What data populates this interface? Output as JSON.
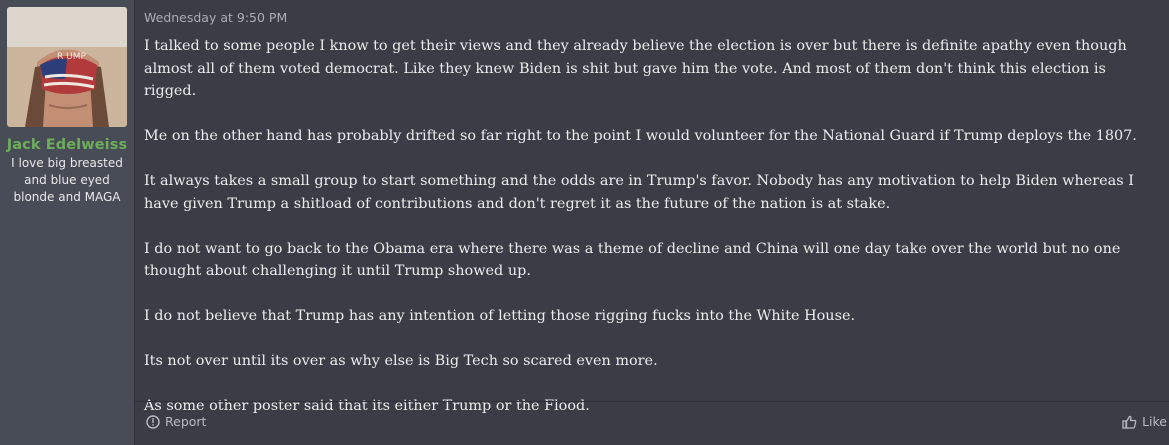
{
  "author": {
    "username": "Jack Edelweiss",
    "user_title": "I love big breasted and blue eyed blonde and MAGA",
    "avatar_icon": "user-avatar-photo"
  },
  "post": {
    "timestamp": "Wednesday at 9:50 PM",
    "paragraphs": [
      "I talked to some people I know to get their views and they already believe the election is over but there is definite apathy even though almost all of them voted democrat. Like they knew Biden is shit but gave him the vote. And most of them don't think this election is rigged.",
      "Me on the other hand has probably drifted so far right to the point I would volunteer for the National Guard if Trump deploys the 1807.",
      "It always takes a small group to start something and the odds are in Trump's favor. Nobody has any motivation to help Biden whereas I have given Trump a shitload of contributions and don't regret it as the future of the nation is at stake.",
      "I do not want to go back to the Obama era where there was a theme of decline and China will one day take over the world but no one thought about challenging it until Trump showed up.",
      "I do not believe that Trump has any intention of letting those rigging fucks into the White House.",
      "Its not over until its over as why else is Big Tech so scared even more.",
      "As some other poster said that its either Trump or the Flood."
    ]
  },
  "actions": {
    "report_label": "Report",
    "report_icon": "report-icon",
    "like_label": "Like",
    "like_icon": "thumbs-up-icon"
  },
  "colors": {
    "username": "#6cae5a",
    "sidebar_bg": "#474c56",
    "main_bg": "#3a3d45"
  }
}
